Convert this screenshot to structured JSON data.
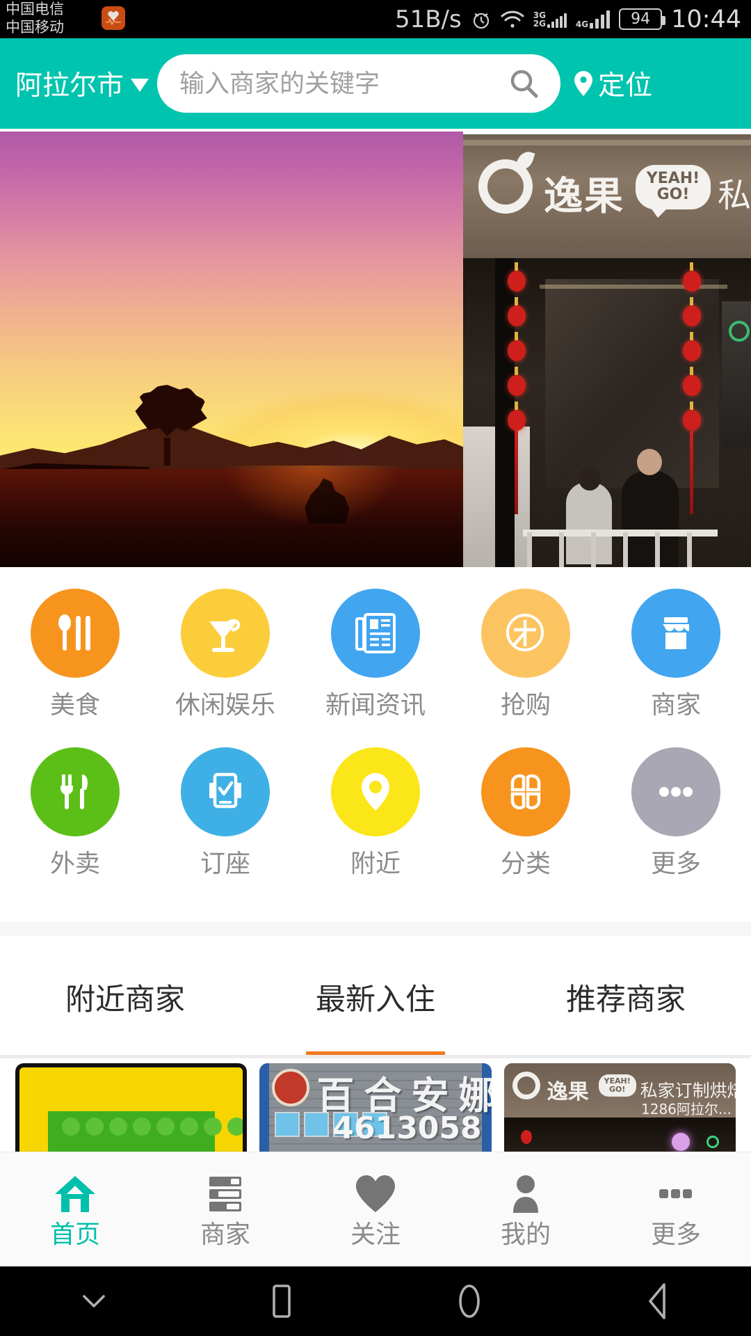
{
  "status_bar": {
    "carrier_line1": "中国电信",
    "carrier_line2": "中国移动",
    "carrier_badge_icon": "heart-pulse-icon",
    "net_speed": "51B/s",
    "alarm_icon": "alarm-clock-icon",
    "wifi_icon": "wifi-icon",
    "sim1_label_top": "3G",
    "sim1_label_bottom": "2G",
    "sim2_label": "4G",
    "battery_level": "94",
    "time": "10:44"
  },
  "header": {
    "city": "阿拉尔市",
    "city_chevron_icon": "chevron-down-icon",
    "search_placeholder": "输入商家的关键字",
    "search_value": "",
    "search_icon": "search-icon",
    "locate_label": "定位",
    "locate_icon": "map-pin-icon",
    "background_color": "#00c4ae"
  },
  "banner": {
    "slides": [
      {
        "name": "sunset-photo",
        "alt": "日落风景"
      },
      {
        "name": "storefront-photo",
        "alt": "逸果 YEAH!GO! 私家店铺"
      }
    ],
    "indicator_color": "#1e88ff",
    "active_index": 0
  },
  "grid": {
    "rows": [
      [
        {
          "label": "美食",
          "icon": "cutlery-spoon-icon",
          "color": "#f7941e"
        },
        {
          "label": "休闲娱乐",
          "icon": "cocktail-glass-icon",
          "color": "#fbcd3a"
        },
        {
          "label": "新闻资讯",
          "icon": "newspaper-icon",
          "color": "#41a5f0"
        },
        {
          "label": "抢购",
          "icon": "circle-arrow-icon",
          "color": "#fcc461"
        },
        {
          "label": "商家",
          "icon": "storefront-icon",
          "color": "#41a5f0"
        }
      ],
      [
        {
          "label": "外卖",
          "icon": "fork-knife-icon",
          "color": "#5cbf17"
        },
        {
          "label": "订座",
          "icon": "phone-check-icon",
          "color": "#3fb0e5"
        },
        {
          "label": "附近",
          "icon": "map-pin-icon",
          "color": "#fbe619"
        },
        {
          "label": "分类",
          "icon": "clover-grid-icon",
          "color": "#f7941e"
        },
        {
          "label": "更多",
          "icon": "ellipsis-icon",
          "color": "#a9a7b3"
        }
      ]
    ]
  },
  "tabs": {
    "items": [
      {
        "label": "附近商家",
        "active": false
      },
      {
        "label": "最新入住",
        "active": true
      },
      {
        "label": "推荐商家",
        "active": false
      }
    ],
    "active_underline_color": "#f57920"
  },
  "cards": [
    {
      "name": "card-green-boat",
      "alt": "黄绿色图案"
    },
    {
      "name": "card-baihe-anna",
      "title": "百合安娜",
      "phone": "4613058"
    },
    {
      "name": "card-yiguo-bakery",
      "brand": "逸果",
      "bubble": "YEAH!\nGO!",
      "tagline": "私家订制烘焙蛋糕",
      "address": "1286阿拉尔..."
    }
  ],
  "bottom_nav": {
    "items": [
      {
        "label": "首页",
        "icon": "home-icon",
        "active": true
      },
      {
        "label": "商家",
        "icon": "list-icon",
        "active": false
      },
      {
        "label": "关注",
        "icon": "heart-icon",
        "active": false
      },
      {
        "label": "我的",
        "icon": "person-icon",
        "active": false
      },
      {
        "label": "更多",
        "icon": "ellipsis-icon",
        "active": false
      }
    ],
    "active_color": "#00c0ab",
    "inactive_color": "#8a8a8a"
  },
  "android_nav": {
    "items": [
      {
        "icon": "chevron-down-icon",
        "name": "hide-navbar-button"
      },
      {
        "icon": "square-icon",
        "name": "recents-button"
      },
      {
        "icon": "circle-icon",
        "name": "home-button"
      },
      {
        "icon": "triangle-left-icon",
        "name": "back-button"
      }
    ]
  }
}
